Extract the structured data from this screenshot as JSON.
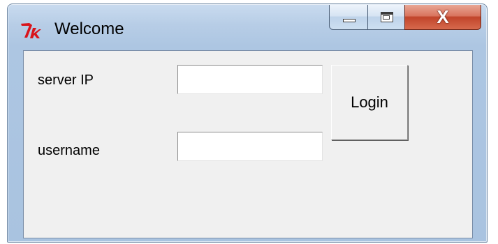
{
  "window": {
    "title": "Welcome",
    "close_glyph": "X"
  },
  "icons": {
    "app": "tk-feather-icon",
    "minimize": "minimize-icon",
    "maximize": "maximize-icon",
    "close": "close-icon"
  },
  "form": {
    "server_label": "server IP",
    "server_value": "",
    "username_label": "username",
    "username_value": "",
    "login_label": "Login"
  },
  "colors": {
    "icon_red": "#d9141b",
    "close_button": "#c1442a",
    "client_bg": "#f0f0f0"
  }
}
